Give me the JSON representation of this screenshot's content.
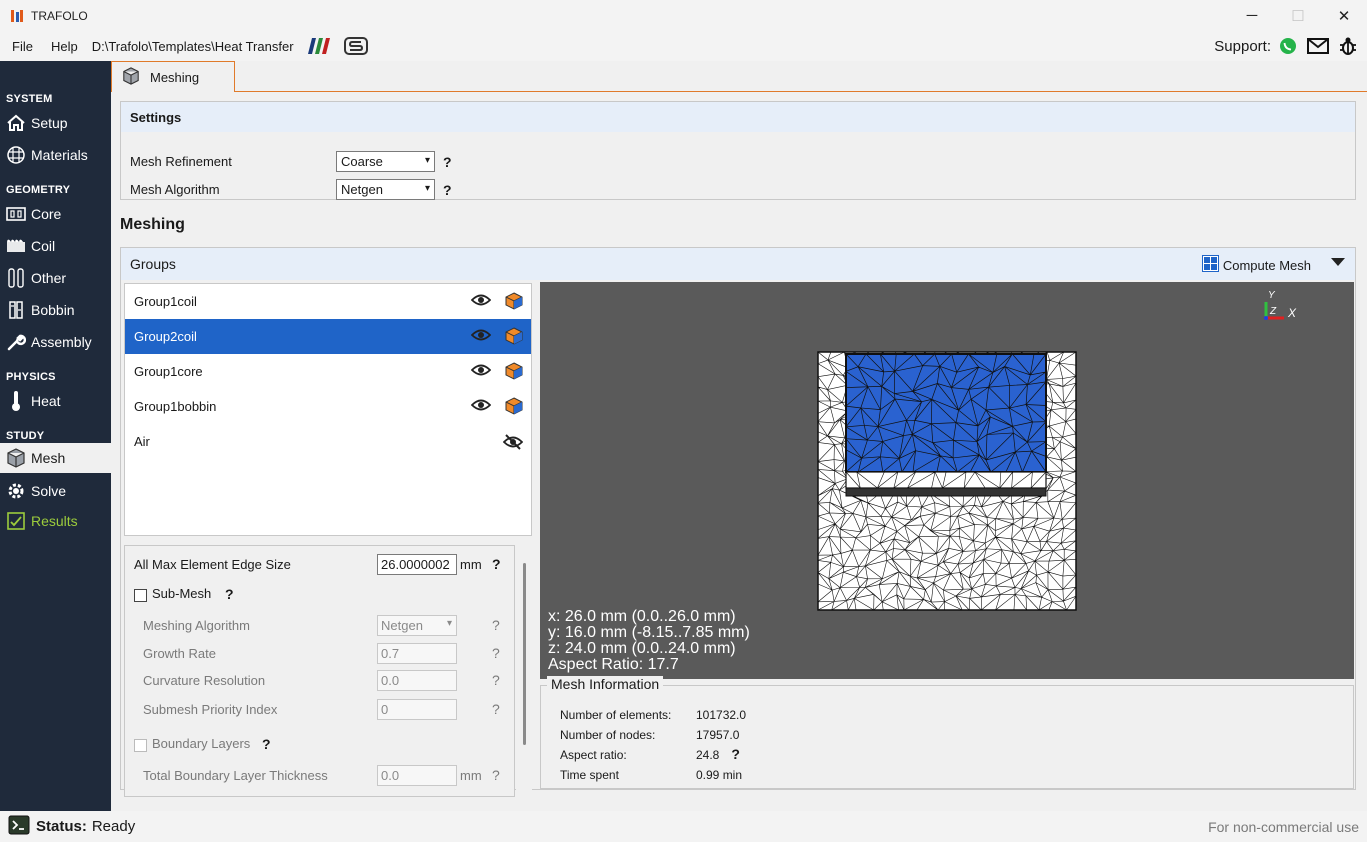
{
  "app": {
    "title": "TRAFOLO"
  },
  "menu": {
    "file": "File",
    "help": "Help",
    "path": "D:\\Trafolo\\Templates\\Heat Transfer",
    "support_label": "Support:"
  },
  "sidebar": {
    "sections": {
      "system": "SYSTEM",
      "geometry": "GEOMETRY",
      "physics": "PHYSICS",
      "study": "STUDY"
    },
    "items": [
      {
        "label": "Setup",
        "icon": "home-icon"
      },
      {
        "label": "Materials",
        "icon": "materials-grid-icon"
      },
      {
        "label": "Core",
        "icon": "core-icon"
      },
      {
        "label": "Coil",
        "icon": "coil-icon"
      },
      {
        "label": "Other",
        "icon": "other-icon"
      },
      {
        "label": "Bobbin",
        "icon": "bobbin-icon"
      },
      {
        "label": "Assembly",
        "icon": "wrench-icon"
      },
      {
        "label": "Heat",
        "icon": "thermometer-icon"
      },
      {
        "label": "Mesh",
        "icon": "mesh-cube-icon"
      },
      {
        "label": "Solve",
        "icon": "solve-gear-icon"
      },
      {
        "label": "Results",
        "icon": "results-chart-icon"
      }
    ]
  },
  "tab": {
    "label": "Meshing"
  },
  "settings": {
    "title": "Settings",
    "mesh_refinement": {
      "label": "Mesh Refinement",
      "value": "Coarse"
    },
    "mesh_algorithm": {
      "label": "Mesh Algorithm",
      "value": "Netgen"
    },
    "help": "?"
  },
  "meshing": {
    "title": "Meshing"
  },
  "groups": {
    "title": "Groups",
    "compute_label": "Compute Mesh",
    "items": [
      {
        "name": "Group1coil",
        "selected": false
      },
      {
        "name": "Group2coil",
        "selected": true
      },
      {
        "name": "Group1core",
        "selected": false
      },
      {
        "name": "Group1bobbin",
        "selected": false
      },
      {
        "name": "Air",
        "selected": false
      }
    ]
  },
  "props": {
    "max_edge": {
      "label": "All Max Element Edge Size",
      "value": "26.0000002",
      "unit": "mm"
    },
    "submesh": {
      "label": "Sub-Mesh"
    },
    "meshing_algorithm": {
      "label": "Meshing Algorithm",
      "value": "Netgen"
    },
    "growth_rate": {
      "label": "Growth Rate",
      "value": "0.7"
    },
    "curvature": {
      "label": "Curvature Resolution",
      "value": "0.0"
    },
    "priority": {
      "label": "Submesh Priority Index",
      "value": "0"
    },
    "boundary_layers": {
      "label": "Boundary Layers"
    },
    "total_thickness": {
      "label": "Total Boundary Layer Thickness",
      "value": "0.0",
      "unit": "mm"
    },
    "help": "?"
  },
  "viewport": {
    "x": "x: 26.0 mm (0.0..26.0 mm)",
    "y": "y: 16.0 mm (-8.15..7.85 mm)",
    "z": "z: 24.0 mm (0.0..24.0 mm)",
    "aspect": "Aspect Ratio: 17.7",
    "axis": {
      "y": "Y",
      "z": "Z",
      "x": "X"
    }
  },
  "mesh_info": {
    "title": "Mesh Information",
    "rows": [
      {
        "label": "Number of elements:",
        "value": "101732.0"
      },
      {
        "label": "Number of nodes:",
        "value": "17957.0"
      },
      {
        "label": "Aspect ratio:",
        "value": "24.8"
      },
      {
        "label": "Time spent",
        "value": "0.99 min"
      }
    ]
  },
  "status": {
    "label": "Status:",
    "value": "Ready",
    "license": "For non-commercial use"
  },
  "colors": {
    "sidebar": "#1f2a3b",
    "selection": "#1f64c8",
    "accent": "#e07a2a",
    "results": "#9ccc3c"
  }
}
